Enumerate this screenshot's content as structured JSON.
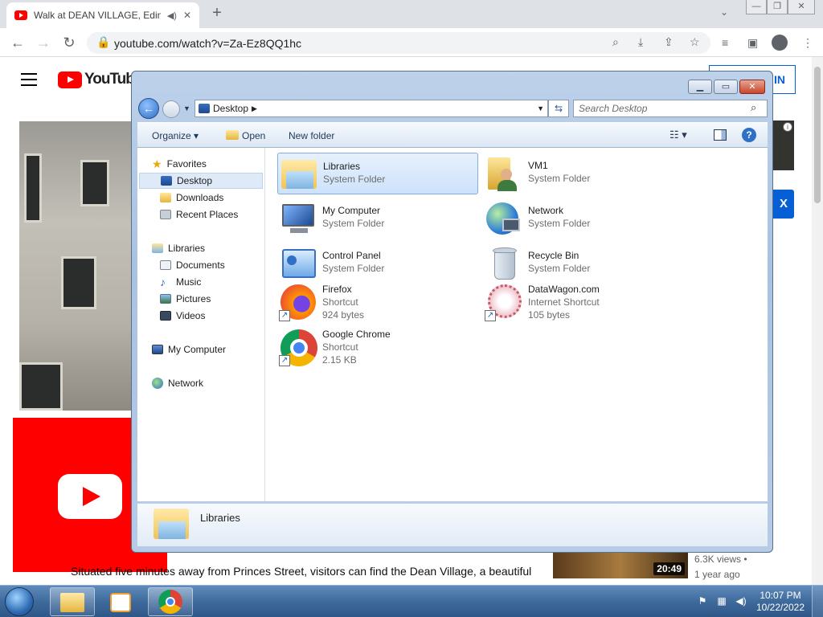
{
  "browser": {
    "tab_title": "Walk at DEAN VILLAGE, Edin",
    "url": "youtube.com/watch?v=Za-Ez8QQ1hc",
    "new_tab_label": "+",
    "tab_close": "✕"
  },
  "youtube": {
    "logo_text": "YouTube",
    "signin_label": "IN",
    "side_badge": "X",
    "description": "Situated five minutes away from Princes Street, visitors can find the Dean Village, a beautiful",
    "related": {
      "duration": "20:49",
      "views": "6.3K views •",
      "age": "1 year ago"
    }
  },
  "explorer": {
    "breadcrumb": "Desktop",
    "search_placeholder": "Search Desktop",
    "commands": {
      "organize": "Organize ▾",
      "open": "Open",
      "new_folder": "New folder"
    },
    "nav": {
      "favorites": "Favorites",
      "favorites_items": [
        "Desktop",
        "Downloads",
        "Recent Places"
      ],
      "libraries": "Libraries",
      "libraries_items": [
        "Documents",
        "Music",
        "Pictures",
        "Videos"
      ],
      "computer": "My Computer",
      "network": "Network"
    },
    "items": [
      {
        "name": "Libraries",
        "line2": "System Folder",
        "line3": ""
      },
      {
        "name": "VM1",
        "line2": "System Folder",
        "line3": ""
      },
      {
        "name": "My Computer",
        "line2": "System Folder",
        "line3": ""
      },
      {
        "name": "Network",
        "line2": "System Folder",
        "line3": ""
      },
      {
        "name": "Control Panel",
        "line2": "System Folder",
        "line3": ""
      },
      {
        "name": "Recycle Bin",
        "line2": "System Folder",
        "line3": ""
      },
      {
        "name": "Firefox",
        "line2": "Shortcut",
        "line3": "924 bytes"
      },
      {
        "name": "DataWagon.com",
        "line2": "Internet Shortcut",
        "line3": "105 bytes"
      },
      {
        "name": "Google Chrome",
        "line2": "Shortcut",
        "line3": "2.15 KB"
      }
    ],
    "details_name": "Libraries"
  },
  "taskbar": {
    "time": "10:07 PM",
    "date": "10/22/2022"
  },
  "colors": {
    "youtube_red": "#ff0000",
    "selection_blue": "#cde2fb",
    "taskbar": "#3f6a9c"
  }
}
